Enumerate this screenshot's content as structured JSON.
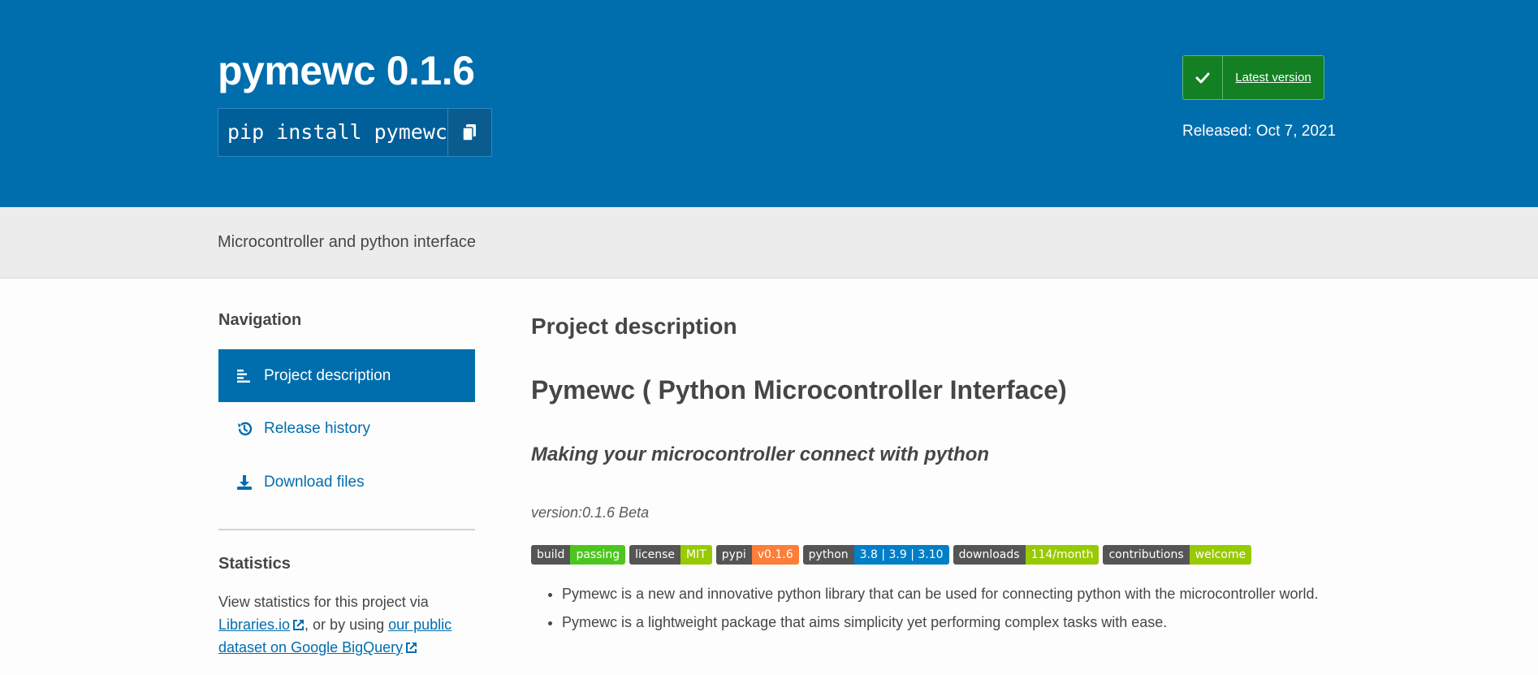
{
  "header": {
    "title": "pymewc 0.1.6",
    "pip_command": "pip install pymewc",
    "copy_icon": "copy-icon",
    "latest_version_label": "Latest version",
    "released": "Released: Oct 7, 2021"
  },
  "summary": "Microcontroller and python interface",
  "sidebar": {
    "navigation_heading": "Navigation",
    "items": [
      {
        "label": "Project description",
        "icon": "align-left-icon",
        "active": true
      },
      {
        "label": "Release history",
        "icon": "history-icon",
        "active": false
      },
      {
        "label": "Download files",
        "icon": "download-icon",
        "active": false
      }
    ],
    "statistics_heading": "Statistics",
    "statistics_prefix": "View statistics for this project via",
    "libraries_link": "Libraries.io",
    "statistics_middle": ", or by using",
    "bigquery_link": "our public dataset on Google BigQuery"
  },
  "main": {
    "section_title": "Project description",
    "readme_title": "Pymewc ( Python Microcontroller Interface)",
    "readme_subtitle": "Making your microcontroller connect with python",
    "version_line": "version:0.1.6 Beta",
    "badges": [
      {
        "left": "build",
        "right": "passing",
        "color": "#4cc61e"
      },
      {
        "left": "license",
        "right": "MIT",
        "color": "#97ca00"
      },
      {
        "left": "pypi",
        "right": "v0.1.6",
        "color": "#fe7d37"
      },
      {
        "left": "python",
        "right": "3.8 | 3.9 | 3.10",
        "color": "#007ec6"
      },
      {
        "left": "downloads",
        "right": "114/month",
        "color": "#97ca00"
      },
      {
        "left": "contributions",
        "right": "welcome",
        "color": "#97ca00"
      }
    ],
    "bullets": [
      "Pymewc is a new and innovative python library that can be used for connecting python with the microcontroller world.",
      "Pymewc is a lightweight package that aims simplicity yet performing complex tasks with ease."
    ]
  },
  "colors": {
    "brand_blue": "#006dad",
    "latest_green": "#148024"
  }
}
